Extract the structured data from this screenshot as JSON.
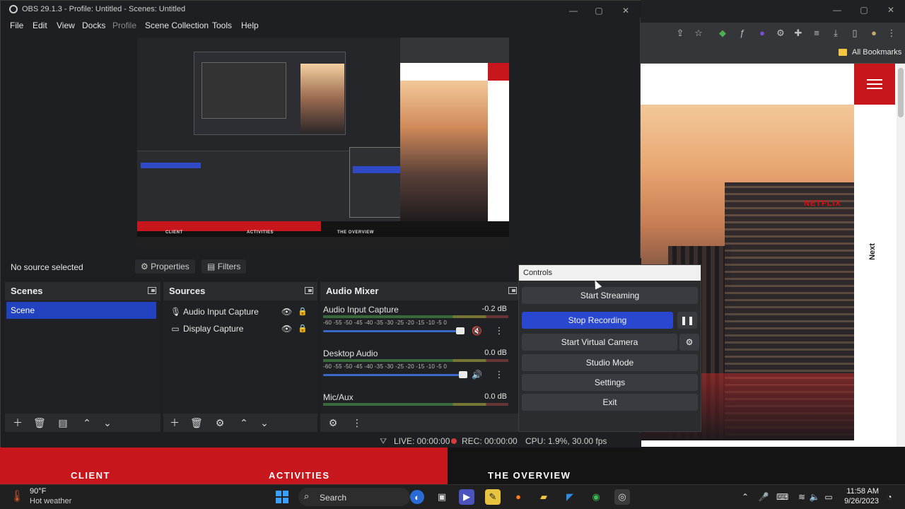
{
  "obs": {
    "title": "OBS 29.1.3 - Profile: Untitled - Scenes: Untitled",
    "menu": [
      "File",
      "Edit",
      "View",
      "Docks",
      "Profile",
      "Scene Collection",
      "Tools",
      "Help"
    ],
    "source_toolbar": {
      "no_source": "No source selected",
      "properties": "Properties",
      "filters": "Filters"
    },
    "scenes": {
      "title": "Scenes",
      "items": [
        "Scene"
      ]
    },
    "sources": {
      "title": "Sources",
      "items": [
        {
          "label": "Audio Input Capture",
          "icon": "microphone-icon"
        },
        {
          "label": "Display Capture",
          "icon": "monitor-icon"
        }
      ]
    },
    "mixer": {
      "title": "Audio Mixer",
      "ticks": "-60  -55  -50  -45  -40  -35  -30  -25  -20  -15  -10   -5   0",
      "channels": [
        {
          "name": "Audio Input Capture",
          "db": "-0.2 dB",
          "muted": true,
          "volume": 0.98
        },
        {
          "name": "Desktop Audio",
          "db": "0.0 dB",
          "muted": false,
          "volume": 1.0
        },
        {
          "name": "Mic/Aux",
          "db": "0.0 dB",
          "muted": false,
          "volume": 1.0
        }
      ]
    },
    "status": {
      "live": "LIVE: 00:00:00",
      "rec": "REC: 00:00:00",
      "cpu": "CPU: 1.9%, 30.00 fps"
    },
    "preview": {
      "client": "CLIENT",
      "activities": "ACTIVITIES",
      "overview": "THE OVERVIEW"
    }
  },
  "controls": {
    "title": "Controls",
    "start_streaming": "Start Streaming",
    "stop_recording": "Stop Recording",
    "start_virtual_camera": "Start Virtual Camera",
    "studio_mode": "Studio Mode",
    "settings": "Settings",
    "exit": "Exit"
  },
  "browser": {
    "bookmarks": "All Bookmarks",
    "hero_sign": "NETFLIX",
    "next": "Next",
    "footer": {
      "client": "CLIENT",
      "activities": "ACTIVITIES",
      "overview": "THE OVERVIEW"
    }
  },
  "taskbar": {
    "weather_temp": "90°F",
    "weather_desc": "Hot weather",
    "search": "Search",
    "time": "11:58 AM",
    "date": "9/26/2023"
  },
  "colors": {
    "accent_blue": "#2a48cf",
    "brand_red": "#c8161d",
    "record_red": "#d63b3b"
  }
}
